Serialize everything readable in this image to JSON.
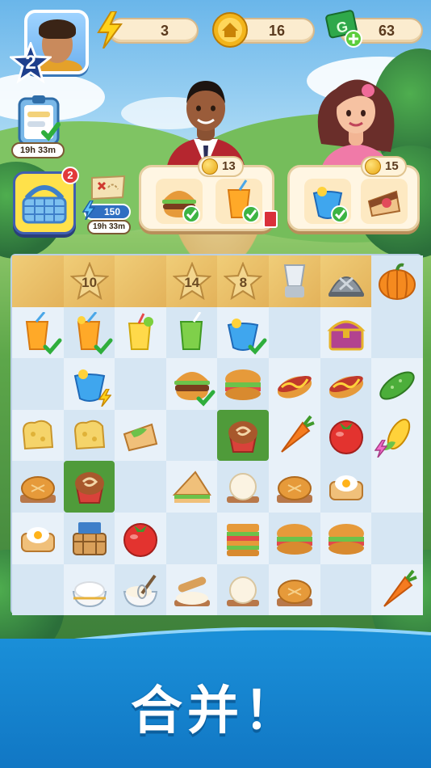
{
  "hud": {
    "player_level": "2",
    "energy": "3",
    "coins": "16",
    "cash": "63"
  },
  "side": {
    "task_timer": "19h 33m",
    "basket_badge": "2",
    "map_energy": "150",
    "map_timer": "19h 33m"
  },
  "orders": [
    {
      "reward": "13",
      "items": [
        "burger",
        "orange-juice"
      ]
    },
    {
      "reward": "15",
      "items": [
        "blue-cocktail",
        "cake-slice"
      ]
    }
  ],
  "board": {
    "lock_values": [
      "10",
      "14",
      "8"
    ]
  },
  "banner": {
    "text": "合并！"
  },
  "colors": {
    "banner": "#1a8fd8",
    "board": "#dbe9f5",
    "locked": "#e3b25a",
    "highlight": "#4f9b3a"
  }
}
